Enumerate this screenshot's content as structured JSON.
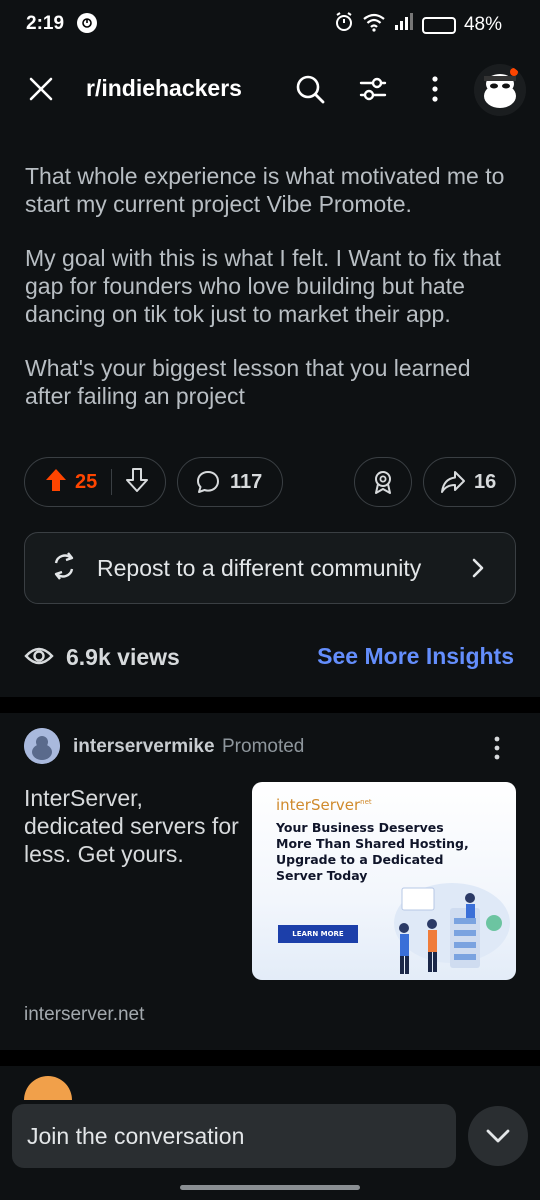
{
  "status_bar": {
    "time": "2:19",
    "battery": "48%",
    "battery_level": 0.48,
    "battery_color": "#f5b800"
  },
  "app_bar": {
    "title": "r/indiehackers",
    "icons": [
      "close-icon",
      "search-icon",
      "filter-icon",
      "more-icon",
      "avatar"
    ]
  },
  "post": {
    "paragraphs": [
      "That whole experience is what motivated me to start my current project Vibe Promote.",
      "My goal with this is what I felt. I Want to fix that gap for founders who love building but hate dancing on tik tok just to market their app.",
      "What's your biggest lesson that you learned after failing an project"
    ],
    "votes": "25",
    "comments": "117",
    "shares": "16",
    "upvote_color": "#ff4500"
  },
  "repost": {
    "label": "Repost to a different community"
  },
  "insights": {
    "views": "6.9k views",
    "see_more": "See More Insights",
    "link_color": "#648efc"
  },
  "ad": {
    "author": "interservermike",
    "promoted": "Promoted",
    "text": "InterServer, dedicated servers for less. Get yours.",
    "image_brand": "interServer",
    "image_brand_suffix": "net",
    "image_headline": "Your Business Deserves More Than Shared Hosting, Upgrade to a Dedicated Server Today",
    "image_cta": "LEARN MORE",
    "domain": "interserver.net"
  },
  "bottom": {
    "join_label": "Join the conversation"
  }
}
